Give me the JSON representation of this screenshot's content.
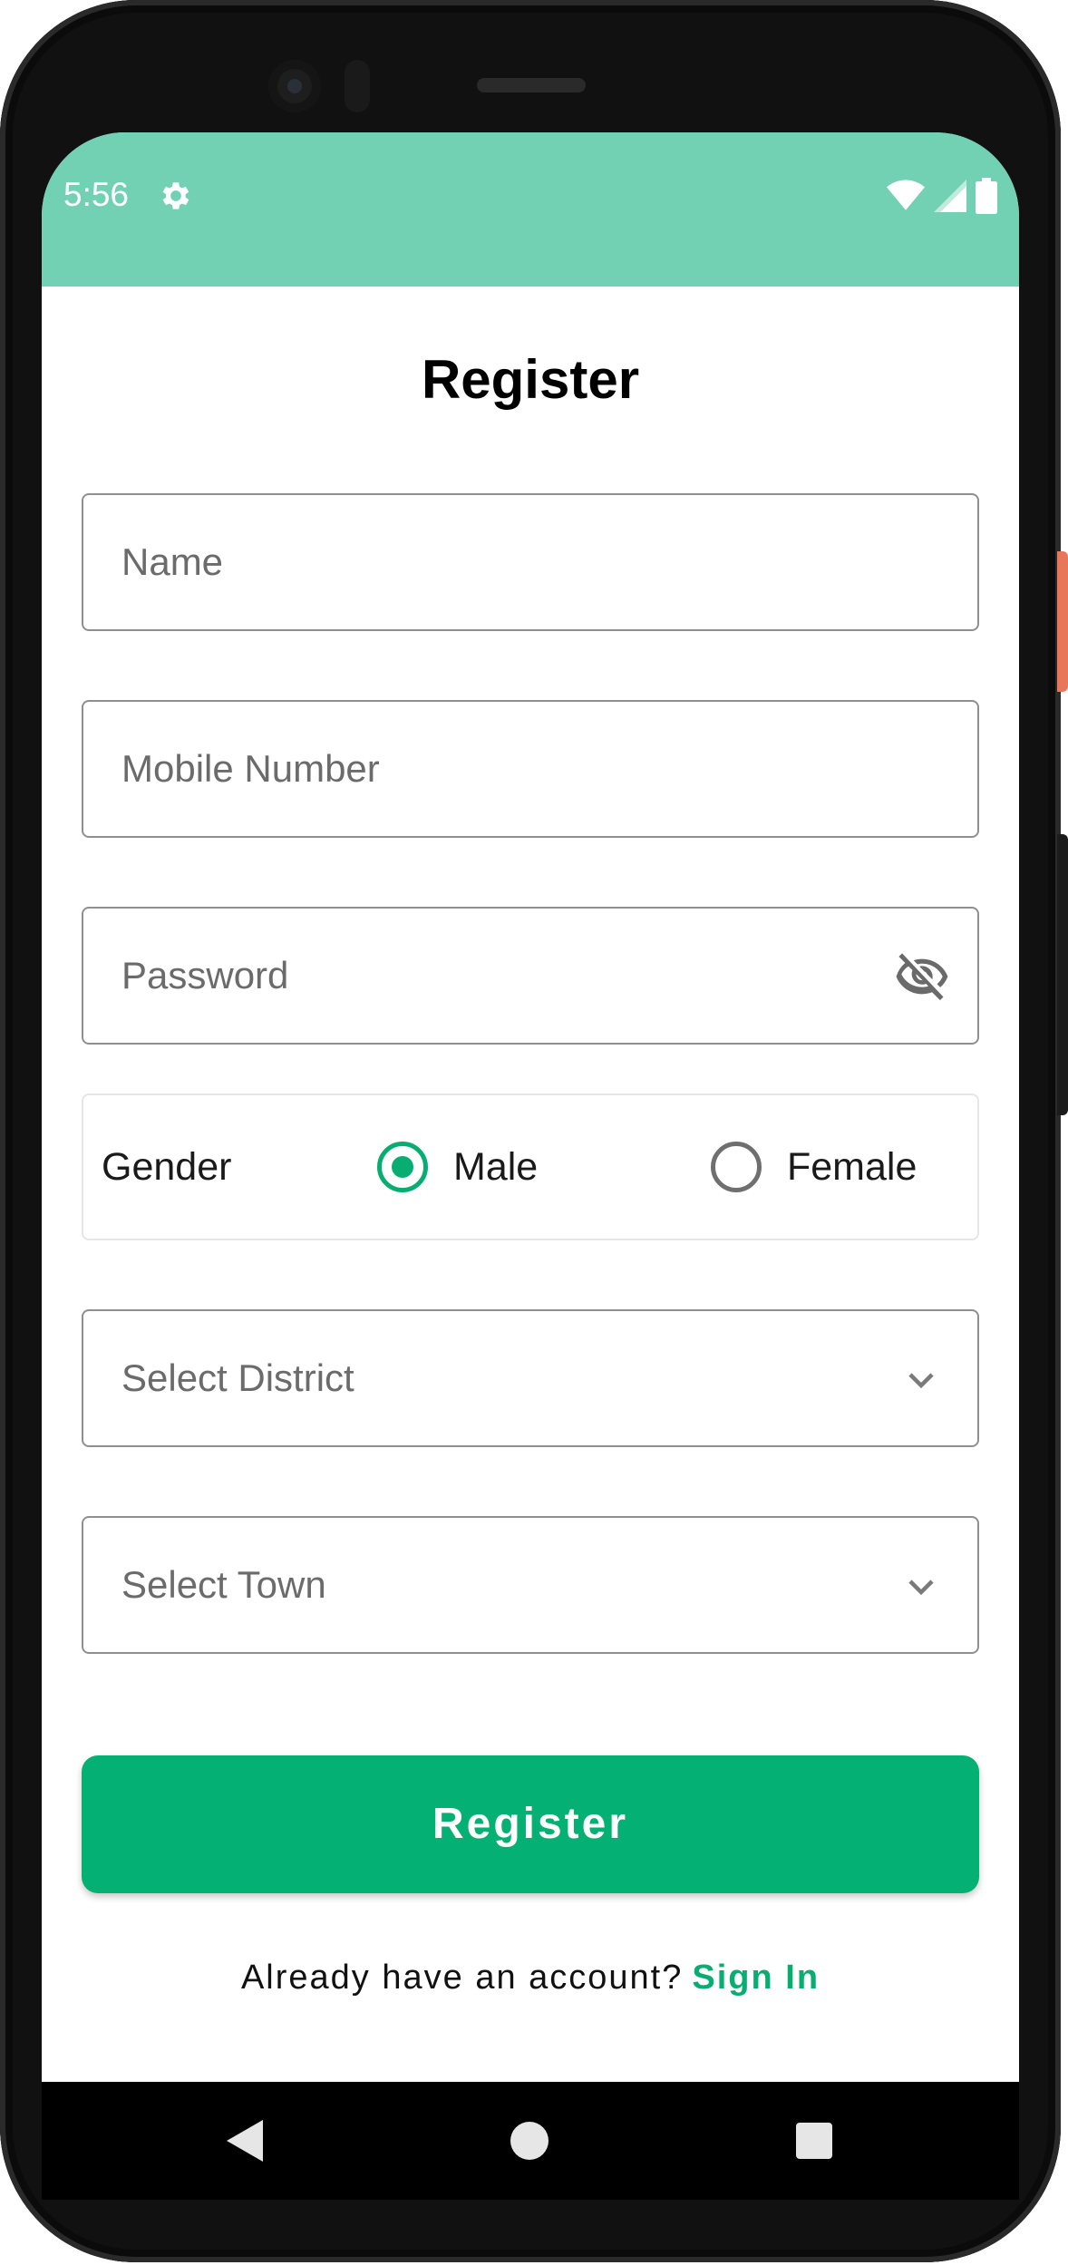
{
  "status_bar": {
    "time": "5:56",
    "icons": [
      "gear-icon",
      "wifi-icon",
      "signal-icon",
      "battery-icon"
    ],
    "background": "#72d1b2"
  },
  "page": {
    "title": "Register"
  },
  "form": {
    "name_placeholder": "Name",
    "mobile_placeholder": "Mobile Number",
    "password_placeholder": "Password",
    "password_toggle_icon": "eye-off-icon",
    "gender": {
      "label": "Gender",
      "options": [
        "Male",
        "Female"
      ],
      "selected": "Male"
    },
    "district_placeholder": "Select District",
    "town_placeholder": "Select Town"
  },
  "actions": {
    "register_label": "Register",
    "signin_prompt": "Already have an account?",
    "signin_link": "Sign In"
  },
  "nav": {
    "icons": [
      "back-icon",
      "home-icon",
      "recents-icon"
    ]
  },
  "colors": {
    "accent": "#04b073",
    "status_bar": "#72d1b2"
  }
}
